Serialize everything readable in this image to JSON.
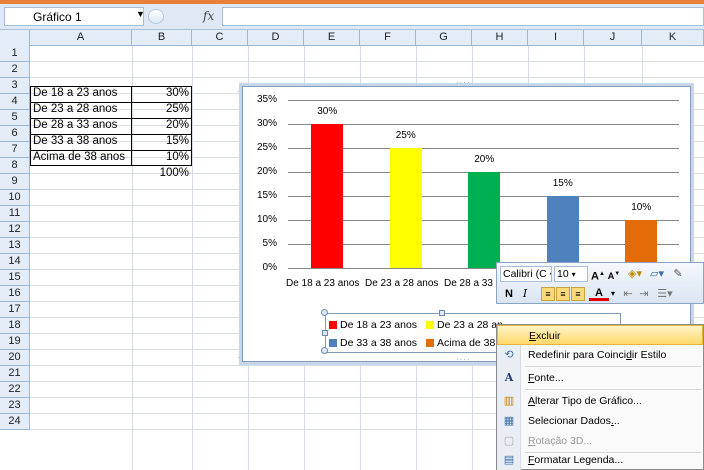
{
  "formula_bar": {
    "name_box": "Gráfico 1",
    "fx_label": "fx",
    "formula": ""
  },
  "columns": [
    "A",
    "B",
    "C",
    "D",
    "E",
    "F",
    "G",
    "H",
    "I",
    "J",
    "K"
  ],
  "rows": [
    "1",
    "2",
    "3",
    "4",
    "5",
    "6",
    "7",
    "8",
    "9",
    "10",
    "11",
    "12",
    "13",
    "14",
    "15",
    "16",
    "17",
    "18",
    "19",
    "20",
    "21",
    "22",
    "23",
    "24"
  ],
  "sheet": {
    "labels": [
      "De 18 a 23 anos",
      "De 23 a 28 anos",
      "De 28 a 33 anos",
      "De 33 a 38 anos",
      "Acima de 38 anos"
    ],
    "values": [
      "30%",
      "25%",
      "20%",
      "15%",
      "10%"
    ],
    "total": "100%"
  },
  "chart_data": {
    "type": "bar",
    "categories": [
      "De 18 a 23 anos",
      "De 23 a 28 anos",
      "De 28 a 33 anos",
      "De 33 a 38 anos",
      "Acima de 38 anos"
    ],
    "values": [
      30,
      25,
      20,
      15,
      10
    ],
    "data_labels": [
      "30%",
      "25%",
      "20%",
      "15%",
      "10%"
    ],
    "bar_colors": [
      "#ff0000",
      "#ffff00",
      "#00b050",
      "#4f81bd",
      "#e36c09"
    ],
    "y_ticks": [
      "0%",
      "5%",
      "10%",
      "15%",
      "20%",
      "25%",
      "30%",
      "35%"
    ],
    "ylim": [
      0,
      35
    ],
    "grid": true,
    "legend_position": "bottom",
    "x_tick_visible": [
      "De 18 a 23 anos",
      "De 23 a 28 anos",
      "De 28 a 33"
    ],
    "legend_visible": [
      "De 18 a 23 anos",
      "De 23 a 28 an",
      "De 33 a 38 anos",
      "Acima de 38 a"
    ]
  },
  "mini_toolbar": {
    "font": "Calibri (C",
    "size": "10",
    "bold": "N",
    "italic": "I"
  },
  "context_menu": {
    "items": [
      {
        "label": "Excluir",
        "icon": "delete-icon"
      },
      {
        "label": "Redefinir para Coincidir Estilo",
        "icon": "reset-style-icon"
      },
      {
        "label": "Fonte...",
        "icon": "font-icon"
      },
      {
        "label": "Alterar Tipo de Gráfico...",
        "icon": "chart-type-icon"
      },
      {
        "label": "Selecionar Dados...",
        "icon": "select-data-icon"
      },
      {
        "label": "Rotação 3D...",
        "icon": "rotation-3d-icon"
      },
      {
        "label": "Formatar Legenda...",
        "icon": "format-legend-icon"
      }
    ]
  }
}
